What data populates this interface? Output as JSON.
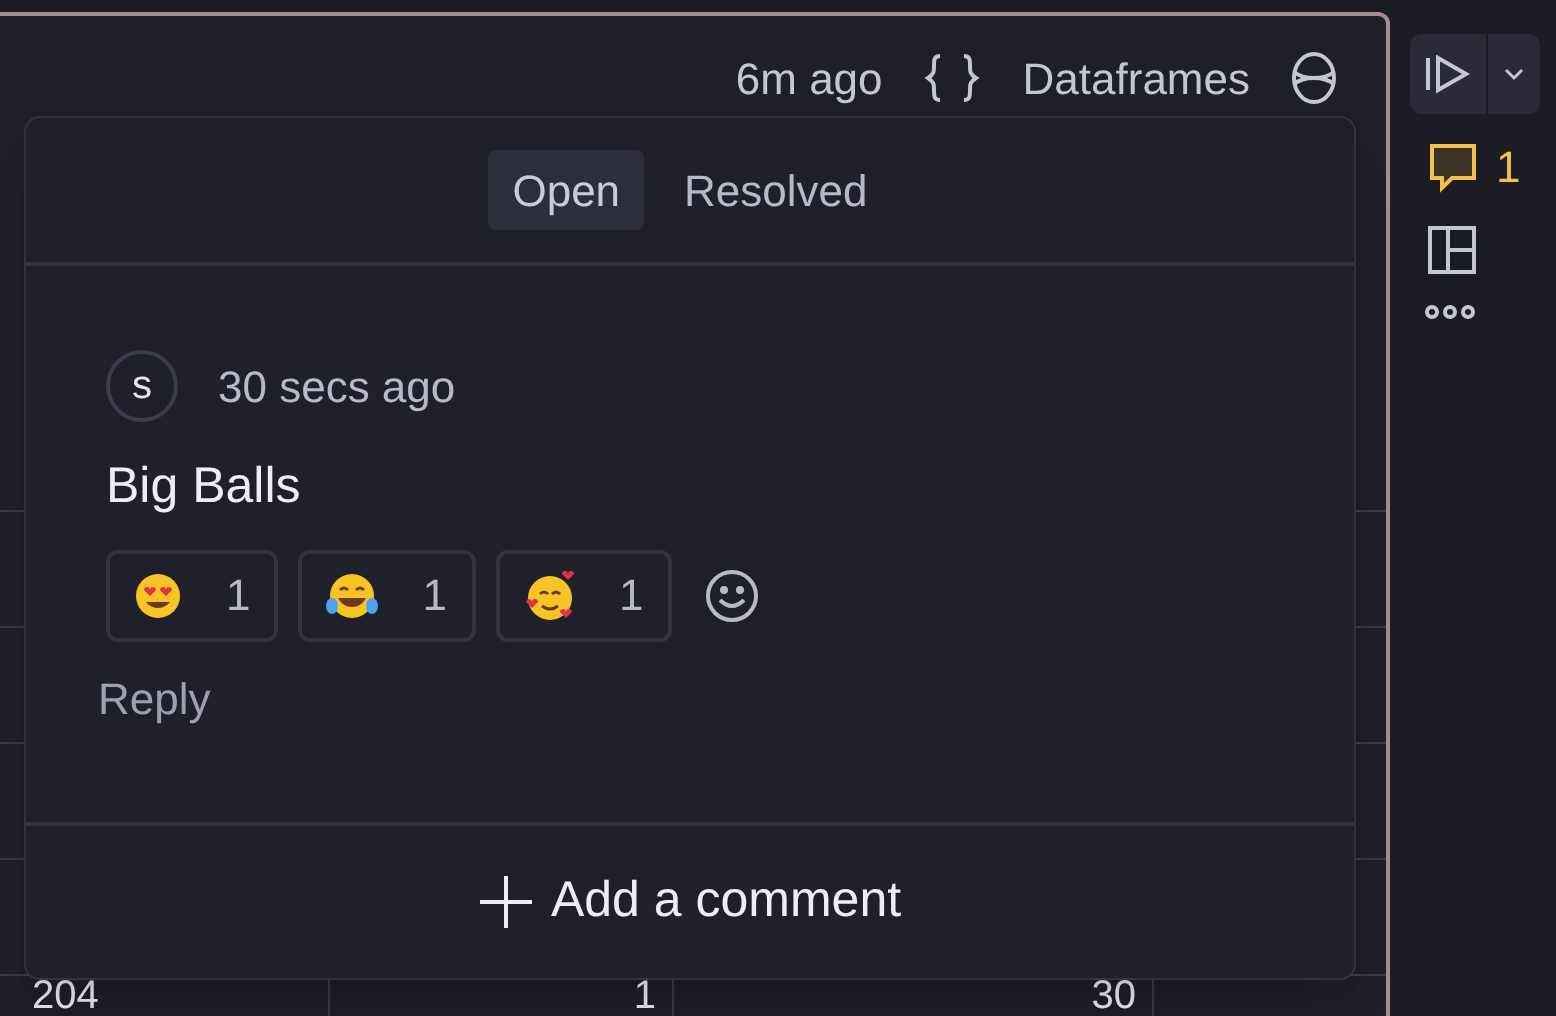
{
  "cell": {
    "updated": "6m ago",
    "dataframes_label": "Dataframes"
  },
  "table_row": [
    "204",
    "1",
    "30"
  ],
  "comments_popover": {
    "tabs": [
      {
        "label": "Open",
        "selected": true
      },
      {
        "label": "Resolved",
        "selected": false
      }
    ],
    "comments": [
      {
        "avatar": "s",
        "time": "30 secs ago",
        "body": "Big Balls",
        "reactions": [
          {
            "kind": "heart-eyes",
            "count": "1"
          },
          {
            "kind": "tears-of-joy",
            "count": "1"
          },
          {
            "kind": "hearts",
            "count": "1"
          }
        ],
        "reply": "Reply"
      }
    ],
    "add_comment": "Add a comment"
  },
  "sidebar": {
    "comment_count": "1"
  }
}
